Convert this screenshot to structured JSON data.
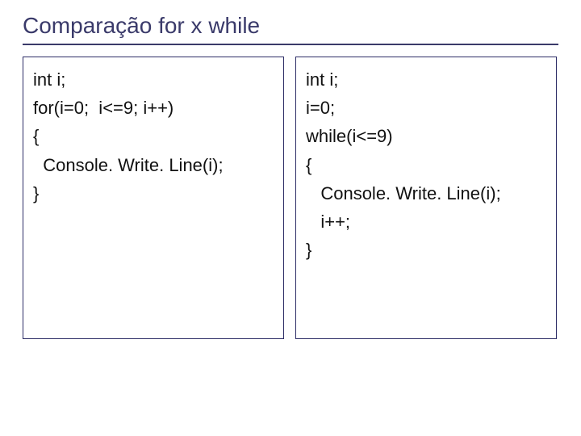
{
  "title": "Comparação for x while",
  "left": {
    "l1": "int i;",
    "l2": "for(i=0;  i<=9; i++)",
    "l3": "{",
    "l4": "  Console. Write. Line(i);",
    "l5": "}"
  },
  "right": {
    "l1": "int i;",
    "l2": "i=0;",
    "l3": "while(i<=9)",
    "l4": "{",
    "l5": "   Console. Write. Line(i);",
    "l6": "   i++;",
    "l7": "}"
  }
}
